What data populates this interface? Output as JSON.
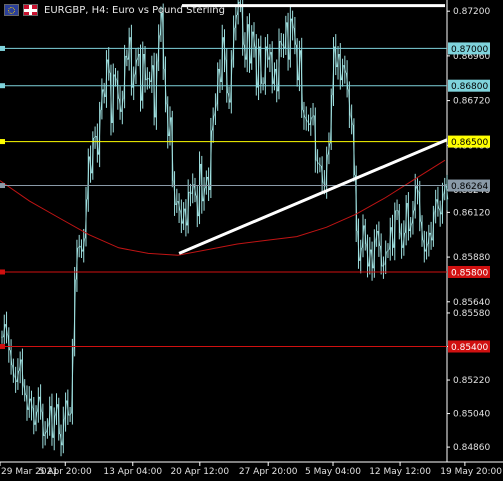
{
  "header": {
    "title": "EURGBP, H4:  Euro vs Pound Sterling",
    "flag_left_icon": "eu-flag-icon",
    "flag_right_icon": "gb-flag-icon"
  },
  "colors": {
    "background": "#000000",
    "candle": "#9fe0e0",
    "ma": "#c01414",
    "cyan_level": "#7fd3dc",
    "gray_level": "#8a9aa8",
    "yellow_level": "#ffff00",
    "red_level": "#d01010",
    "trendline": "#ffffff"
  },
  "chart_data": {
    "type": "candlestick",
    "symbol": "EURGBP",
    "timeframe": "H4",
    "ylim": [
      0.8478,
      0.8726
    ],
    "y_ticks": [
      "0.87200",
      "0.86960",
      "0.86720",
      "0.86480",
      "0.86240",
      "0.86120",
      "0.85880",
      "0.85640",
      "0.85580",
      "0.85400",
      "0.85220",
      "0.85040",
      "0.84860"
    ],
    "x_ticks": [
      "29 Mar 2021",
      "5 Apr 20:00",
      "13 Apr 04:00",
      "20 Apr 12:00",
      "27 Apr 20:00",
      "5 May 04:00",
      "12 May 12:00",
      "19 May 20:00"
    ],
    "close_path": [
      0.8545,
      0.8552,
      0.8546,
      0.8538,
      0.853,
      0.8524,
      0.8521,
      0.8527,
      0.8533,
      0.8519,
      0.8514,
      0.8506,
      0.8512,
      0.8507,
      0.8498,
      0.8505,
      0.8513,
      0.8505,
      0.8492,
      0.8494,
      0.8498,
      0.8508,
      0.8491,
      0.8503,
      0.8509,
      0.8493,
      0.8487,
      0.8501,
      0.8511,
      0.8503,
      0.8504,
      0.8539,
      0.8576,
      0.8593,
      0.8594,
      0.8591,
      0.8598,
      0.8619,
      0.8642,
      0.8633,
      0.8652,
      0.8653,
      0.8643,
      0.8667,
      0.8678,
      0.8674,
      0.8694,
      0.8687,
      0.866,
      0.8686,
      0.8683,
      0.8673,
      0.8666,
      0.8673,
      0.8696,
      0.8694,
      0.8706,
      0.8679,
      0.8686,
      0.8694,
      0.8697,
      0.8672,
      0.8697,
      0.8683,
      0.8684,
      0.8682,
      0.8691,
      0.8663,
      0.8693,
      0.8707,
      0.8719,
      0.8689,
      0.867,
      0.8653,
      0.8663,
      0.8629,
      0.8616,
      0.8618,
      0.8613,
      0.8606,
      0.8614,
      0.8605,
      0.8623,
      0.8622,
      0.8627,
      0.8621,
      0.861,
      0.8638,
      0.8618,
      0.8625,
      0.8631,
      0.8624,
      0.8656,
      0.8664,
      0.867,
      0.8689,
      0.8682,
      0.8706,
      0.8694,
      0.8676,
      0.8671,
      0.8694,
      0.8711,
      0.8718,
      0.8725,
      0.8723,
      0.8702,
      0.8694,
      0.8713,
      0.8692,
      0.8709,
      0.8701,
      0.8679,
      0.8701,
      0.8681,
      0.8681,
      0.8701,
      0.8694,
      0.8698,
      0.8681,
      0.8689,
      0.8677,
      0.8704,
      0.8702,
      0.87,
      0.8714,
      0.8694,
      0.8716,
      0.8711,
      0.8702,
      0.8683,
      0.8699,
      0.8667,
      0.8663,
      0.8661,
      0.8659,
      0.8663,
      0.8664,
      0.864,
      0.8638,
      0.8637,
      0.8628,
      0.8626,
      0.8643,
      0.8649,
      0.8675,
      0.8701,
      0.869,
      0.8697,
      0.8683,
      0.8691,
      0.8687,
      0.8678,
      0.8664,
      0.8659,
      0.8632,
      0.8602,
      0.8586,
      0.8593,
      0.8605,
      0.8595,
      0.8583,
      0.8592,
      0.8582,
      0.8597,
      0.8602,
      0.8594,
      0.8583,
      0.8584,
      0.8591,
      0.8592,
      0.8604,
      0.8593,
      0.8613,
      0.8613,
      0.8601,
      0.8593,
      0.8601,
      0.8617,
      0.8602,
      0.8606,
      0.8613,
      0.8626,
      0.8623,
      0.8607,
      0.8597,
      0.8591,
      0.8595,
      0.8601,
      0.8597,
      0.8612,
      0.8619,
      0.8614,
      0.8611,
      0.8622,
      0.8627,
      0.8619
    ]
  },
  "moving_average": [
    0.8629,
    0.8618,
    0.8609,
    0.86,
    0.8593,
    0.859,
    0.8589,
    0.8592,
    0.8595,
    0.8597,
    0.8599,
    0.8604,
    0.8611,
    0.862,
    0.863,
    0.864
  ],
  "levels": [
    {
      "label": "0.87000",
      "value": 0.87,
      "kind": "cyan"
    },
    {
      "label": "0.86800",
      "value": 0.868,
      "kind": "cyan"
    },
    {
      "label": "0.86500",
      "value": 0.865,
      "kind": "yellow"
    },
    {
      "label": "0.86264",
      "value": 0.86264,
      "kind": "gray"
    },
    {
      "label": "0.85800",
      "value": 0.858,
      "kind": "red"
    },
    {
      "label": "0.85400",
      "value": 0.854,
      "kind": "red"
    }
  ],
  "trendline": {
    "from": [
      0.3,
      0.859
    ],
    "to": [
      1.0,
      0.8651
    ]
  },
  "top_line": {
    "value": 0.8723
  }
}
